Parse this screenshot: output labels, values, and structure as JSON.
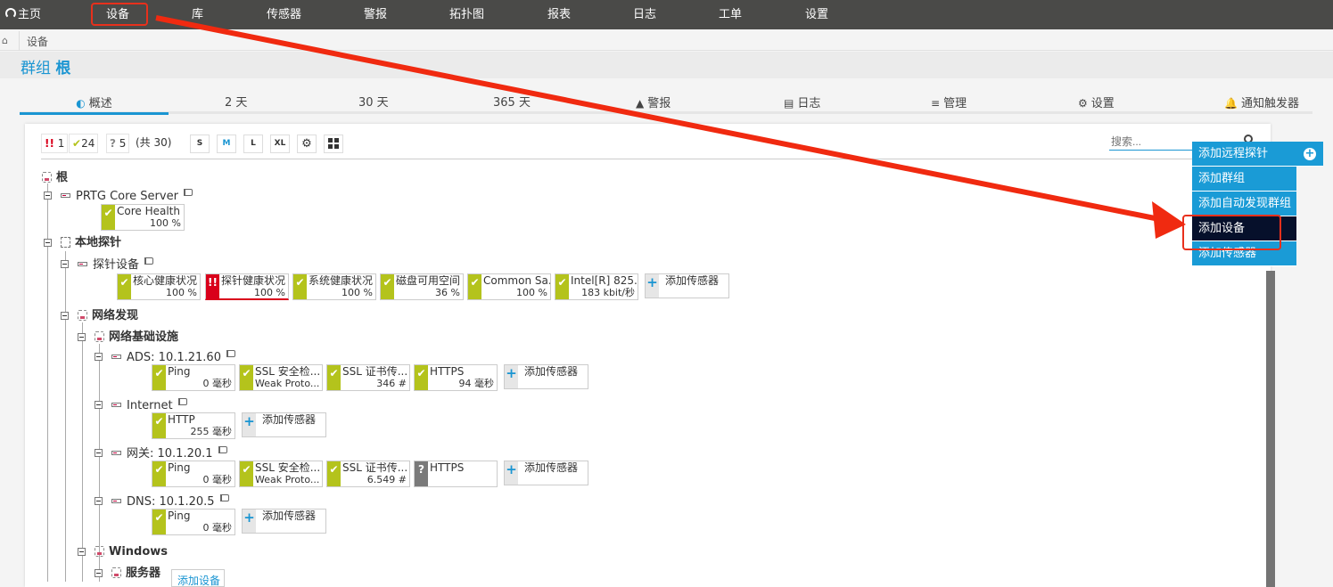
{
  "topnav": {
    "items": [
      {
        "label": "主页",
        "icon": "gauge-icon"
      },
      {
        "label": "设备"
      },
      {
        "label": "库"
      },
      {
        "label": "传感器"
      },
      {
        "label": "警报"
      },
      {
        "label": "拓扑图"
      },
      {
        "label": "报表"
      },
      {
        "label": "日志"
      },
      {
        "label": "工单"
      },
      {
        "label": "设置"
      }
    ]
  },
  "breadcrumb": {
    "home_icon": "home-icon",
    "current": "设备"
  },
  "page_title": {
    "prefix": "群组",
    "name": "根"
  },
  "tabs": [
    {
      "label": "概述",
      "icon": "gauge-icon",
      "active": true
    },
    {
      "label": "2  天"
    },
    {
      "label": "30 天"
    },
    {
      "label": "365 天"
    },
    {
      "label": "警报",
      "icon": "warning-icon"
    },
    {
      "label": "日志",
      "icon": "log-icon"
    },
    {
      "label": "管理",
      "icon": "sliders-icon"
    },
    {
      "label": "设置",
      "icon": "gear-icon"
    },
    {
      "label": "通知触发器",
      "icon": "bell-icon"
    }
  ],
  "toolbar": {
    "down_count": "1",
    "up_count": "24",
    "unknown_count": "5",
    "total": "(共 30)",
    "sizes": [
      "S",
      "M",
      "L",
      "XL"
    ],
    "active_size": "M"
  },
  "search": {
    "placeholder": "搜索..."
  },
  "tree": {
    "root": "根",
    "core_server": {
      "name": "PRTG Core Server",
      "sensors": [
        {
          "name": "Core Health ...",
          "value": "100 %",
          "status": "up"
        }
      ]
    },
    "local_probe": "本地探针",
    "probe_device": {
      "name": "探针设备",
      "sensors": [
        {
          "name": "核心健康状况",
          "value": "100 %",
          "status": "up"
        },
        {
          "name": "探针健康状况",
          "value": "100 %",
          "status": "down"
        },
        {
          "name": "系统健康状况",
          "value": "100 %",
          "status": "up"
        },
        {
          "name": "磁盘可用空间",
          "value": "36 %",
          "status": "up"
        },
        {
          "name": "Common Sa...",
          "value": "100 %",
          "status": "up"
        },
        {
          "name": "Intel[R] 825...",
          "value": "183 kbit/秒",
          "status": "up"
        }
      ]
    },
    "network_discovery": "网络发现",
    "infrastructure": "网络基础设施",
    "ads": {
      "name": "ADS: 10.1.21.60",
      "sensors": [
        {
          "name": "Ping",
          "value": "0 毫秒",
          "status": "up"
        },
        {
          "name": "SSL 安全检...",
          "value": "Weak Proto...",
          "status": "up"
        },
        {
          "name": "SSL 证书传...",
          "value": "346 #",
          "status": "up"
        },
        {
          "name": "HTTPS",
          "value": "94 毫秒",
          "status": "up"
        }
      ]
    },
    "internet": {
      "name": "Internet",
      "sensors": [
        {
          "name": "HTTP",
          "value": "255 毫秒",
          "status": "up"
        }
      ]
    },
    "gateway": {
      "name": "网关: 10.1.20.1",
      "sensors": [
        {
          "name": "Ping",
          "value": "0 毫秒",
          "status": "up"
        },
        {
          "name": "SSL 安全检...",
          "value": "Weak Proto...",
          "status": "up"
        },
        {
          "name": "SSL 证书传...",
          "value": "6.549 #",
          "status": "up"
        },
        {
          "name": "HTTPS",
          "value": "",
          "status": "unknown"
        }
      ]
    },
    "dns": {
      "name": "DNS: 10.1.20.5",
      "sensors": [
        {
          "name": "Ping",
          "value": "0 毫秒",
          "status": "up"
        }
      ]
    },
    "windows": "Windows",
    "servers": "服务器",
    "add_sensor_label": "添加传感器",
    "add_device_label": "添加设备"
  },
  "context_menu": {
    "items": [
      {
        "label": "添加远程探针"
      },
      {
        "label": "添加群组"
      },
      {
        "label": "添加自动发现群组"
      },
      {
        "label": "添加设备",
        "selected": true
      },
      {
        "label": "添加传感器"
      }
    ]
  },
  "colors": {
    "accent": "#1a95d2",
    "up": "#b4c31c",
    "down": "#d9001b",
    "unknown": "#7a7a7a",
    "annotation": "#e8301c"
  }
}
